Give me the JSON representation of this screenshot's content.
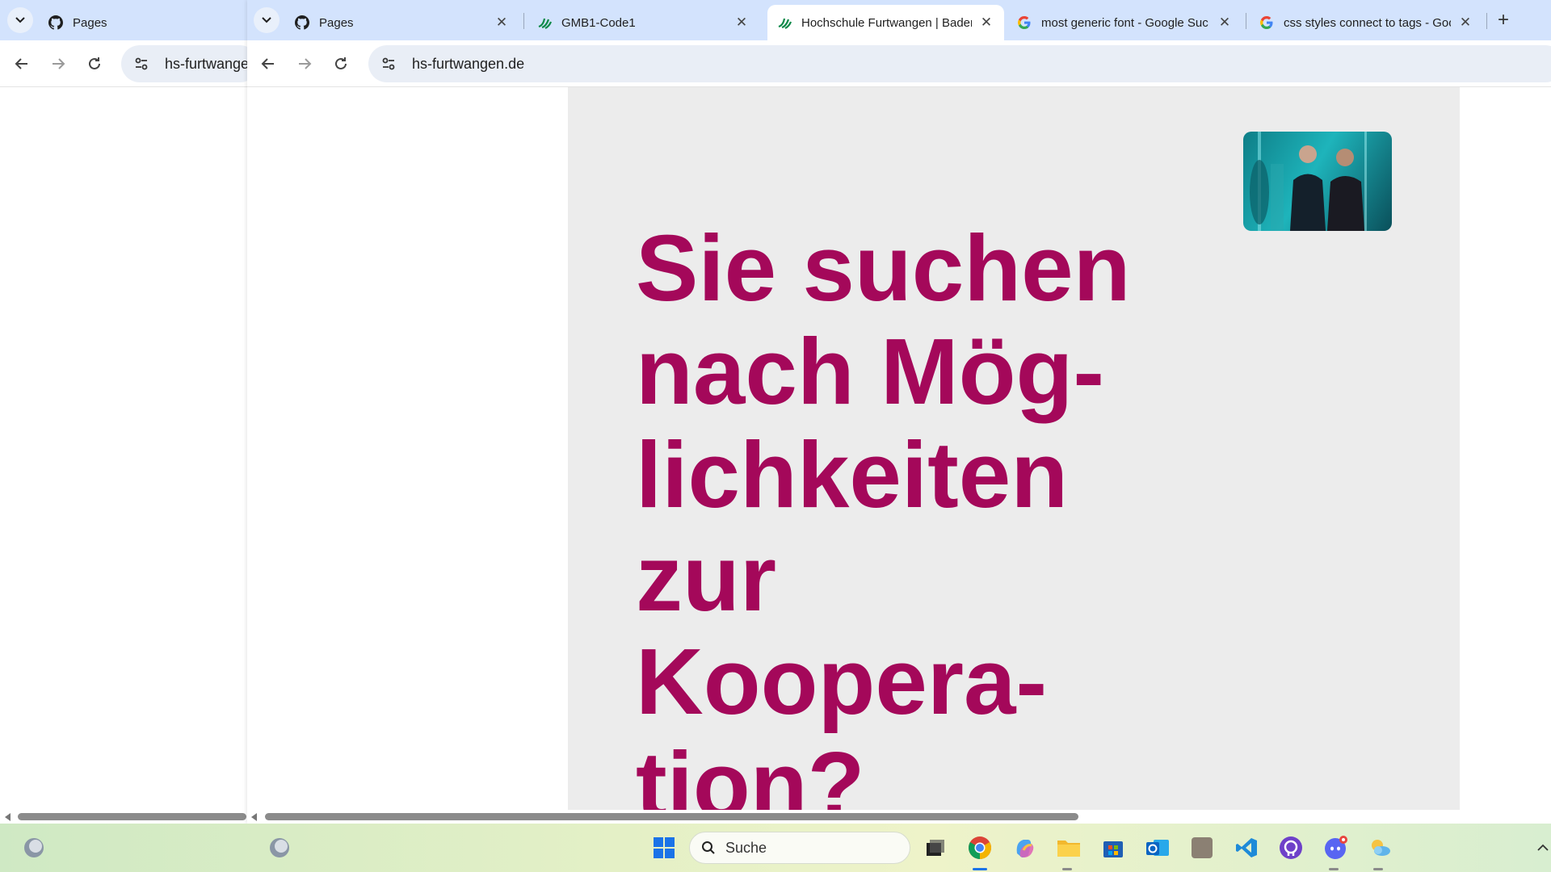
{
  "left_window": {
    "tab_title": "Pages",
    "url": "hs-furtwangen"
  },
  "tabs": [
    {
      "title": "Pages",
      "favicon": "github-icon"
    },
    {
      "title": "GMB1-Code1",
      "favicon": "hfu-leaf-icon"
    },
    {
      "title": "Hochschule Furtwangen | Baden",
      "favicon": "hfu-leaf-icon",
      "active": true
    },
    {
      "title": "most generic font - Google Suc",
      "favicon": "google-icon"
    },
    {
      "title": "css styles connect to tags - Goo",
      "favicon": "google-icon"
    }
  ],
  "address_bar": {
    "url": "hs-furtwangen.de"
  },
  "page": {
    "headline_lines": [
      "Sie suchen",
      "nach Mög-",
      "lichkeiten",
      "zur",
      "Koopera-",
      "tion?"
    ],
    "headline_color": "#a4085a",
    "panel_color": "#ececec"
  },
  "taskbar": {
    "search_label": "Suche",
    "apps": [
      "windows-start-icon",
      "search-icon",
      "task-view-icon",
      "chrome-icon",
      "copilot-icon",
      "file-explorer-icon",
      "microsoft-store-icon",
      "outlook-icon",
      "blank-app-icon",
      "vscode-icon",
      "github-desktop-icon",
      "discord-icon",
      "weather-app-icon"
    ]
  }
}
